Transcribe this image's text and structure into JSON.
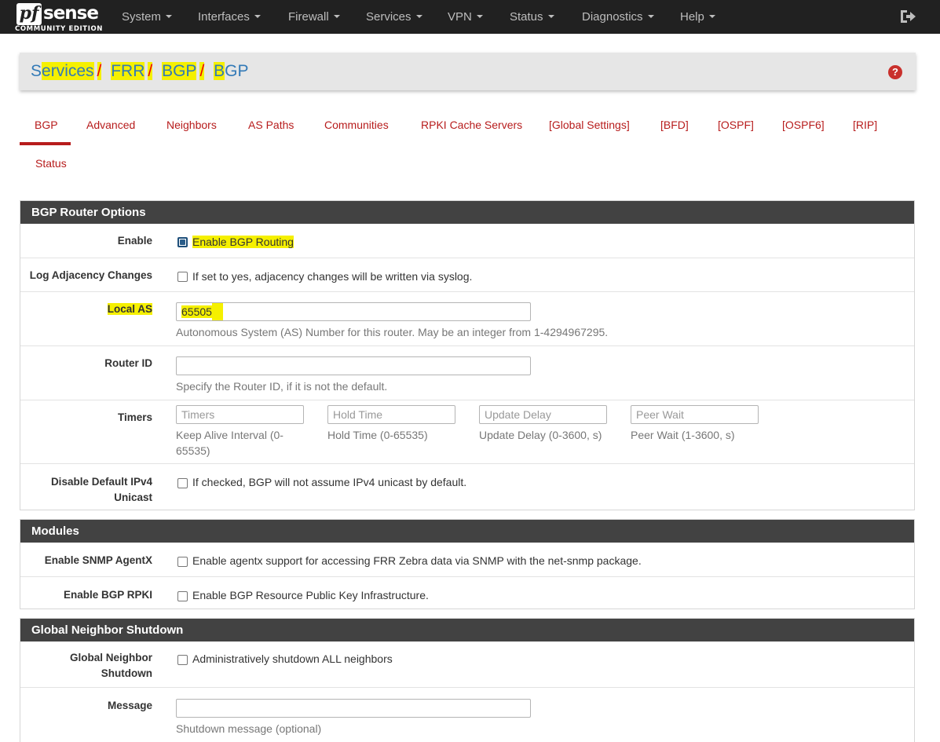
{
  "brand": {
    "logo_pf": "pf",
    "logo_sense": "sense",
    "edition": "COMMUNITY EDITION"
  },
  "nav": {
    "items": [
      "System",
      "Interfaces",
      "Firewall",
      "Services",
      "VPN",
      "Status",
      "Diagnostics",
      "Help"
    ]
  },
  "breadcrumb": {
    "parts": [
      "Services",
      "FRR",
      "BGP",
      "BGP"
    ],
    "separator": "/"
  },
  "help_icon": "?",
  "tabs": {
    "items": [
      "BGP",
      "Advanced",
      "Neighbors",
      "AS Paths",
      "Communities",
      "RPKI Cache Servers",
      "[Global Settings]",
      "[BFD]",
      "[OSPF]",
      "[OSPF6]",
      "[RIP]",
      "Status"
    ],
    "active": "BGP"
  },
  "router_options": {
    "heading": "BGP Router Options",
    "enable": {
      "label": "Enable",
      "text": "Enable BGP Routing",
      "checked": true
    },
    "log_adjacency": {
      "label": "Log Adjacency Changes",
      "text": "If set to yes, adjacency changes will be written via syslog.",
      "checked": false
    },
    "local_as": {
      "label": "Local AS",
      "value": "65505",
      "help": "Autonomous System (AS) Number for this router. May be an integer from 1-4294967295."
    },
    "router_id": {
      "label": "Router ID",
      "value": "",
      "help": "Specify the Router ID, if it is not the default."
    },
    "timers": {
      "label": "Timers",
      "keepalive": {
        "placeholder": "Timers",
        "help_line1": "Keep Alive Interval (0-",
        "help_line2": "65535)"
      },
      "hold": {
        "placeholder": "Hold Time",
        "help": "Hold Time (0-65535)"
      },
      "update": {
        "placeholder": "Update Delay",
        "help": "Update Delay (0-3600, s)"
      },
      "peer": {
        "placeholder": "Peer Wait",
        "help": "Peer Wait (1-3600, s)"
      }
    },
    "disable_ipv4": {
      "label_line1": "Disable Default IPv4",
      "label_line2": "Unicast",
      "text": "If checked, BGP will not assume IPv4 unicast by default.",
      "checked": false
    }
  },
  "modules": {
    "heading": "Modules",
    "snmp": {
      "label": "Enable SNMP AgentX",
      "text": "Enable agentx support for accessing FRR Zebra data via SNMP with the net-snmp package.",
      "checked": false
    },
    "rpki": {
      "label": "Enable BGP RPKI",
      "text": "Enable BGP Resource Public Key Infrastructure.",
      "checked": false
    }
  },
  "shutdown": {
    "heading": "Global Neighbor Shutdown",
    "global": {
      "label_line1": "Global Neighbor",
      "label_line2": "Shutdown",
      "text": "Administratively shutdown ALL neighbors",
      "checked": false
    },
    "message": {
      "label": "Message",
      "value": "",
      "help": "Shutdown message (optional)"
    }
  },
  "colors": {
    "navbar": "#212121",
    "accent": "#b71c1c",
    "panel_heading": "#424242",
    "highlight": "#f5f000",
    "link": "#337ab7"
  }
}
